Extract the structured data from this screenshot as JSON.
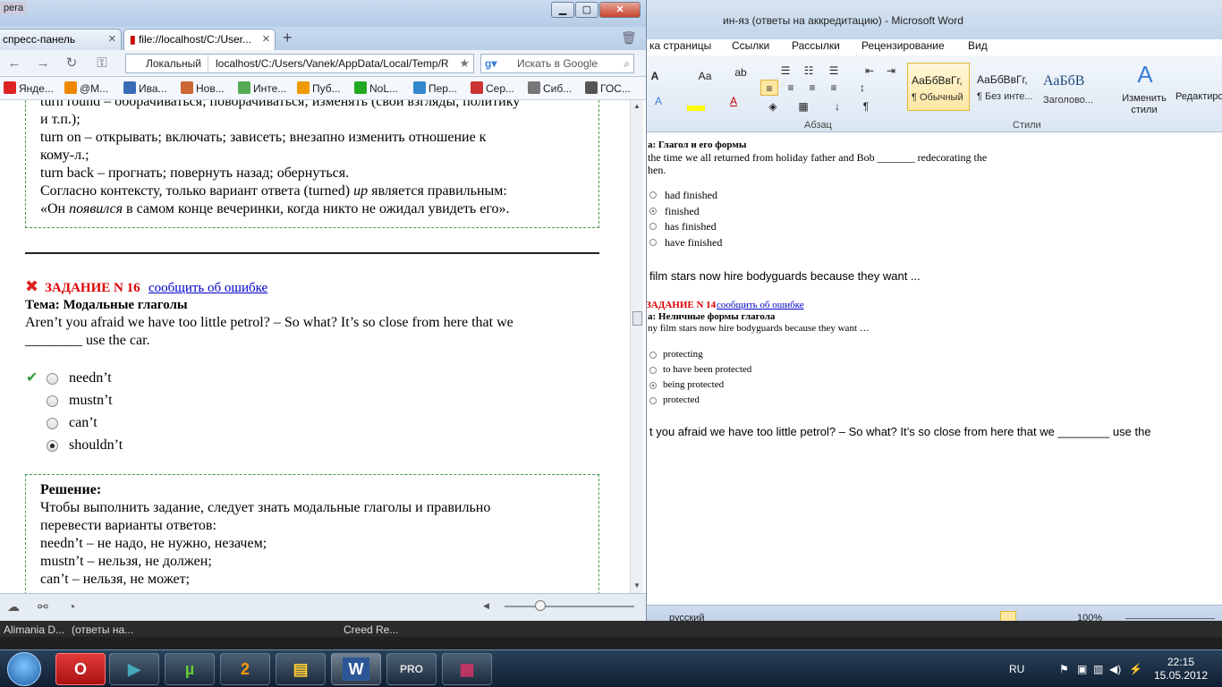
{
  "browser": {
    "app_label": "pera",
    "tabs": [
      {
        "label": "спресс-панель"
      },
      {
        "label": "file://localhost/C:/User..."
      }
    ],
    "new_tab": "+",
    "address": {
      "security_label": "Локальный",
      "url": "localhost/C:/Users/Vanek/AppData/Local/Temp/R"
    },
    "search": {
      "placeholder": "Искать в Google"
    },
    "bookmarks": [
      {
        "label": "Янде...",
        "color": "#d22"
      },
      {
        "label": "@M...",
        "color": "#e80"
      },
      {
        "label": "Ива...",
        "color": "#3a6bb8"
      },
      {
        "label": "Нов...",
        "color": "#c63"
      },
      {
        "label": "Инте...",
        "color": "#5a5"
      },
      {
        "label": "Пуб...",
        "color": "#e90"
      },
      {
        "label": "NoL...",
        "color": "#2a2"
      },
      {
        "label": "Пер...",
        "color": "#38c"
      },
      {
        "label": "Сер...",
        "color": "#c33"
      },
      {
        "label": "Сиб...",
        "color": "#777"
      },
      {
        "label": "ГОС...",
        "color": "#555"
      }
    ],
    "content": {
      "prev_solution": [
        "turn round – оборачиваться; поворачиваться; изменять (свои взгляды, политику",
        "и т.п.);",
        "turn on – открывать; включать; зависеть; внезапно изменить отношение к",
        "кому-л.;",
        "turn back – прогнать; повернуть назад; обернуться."
      ],
      "prev_conclusion_a": "Согласно контексту, только вариант ответа (turned) ",
      "prev_conclusion_b": "up",
      "prev_conclusion_c": " является правильным:",
      "prev_translation_a": "«Он ",
      "prev_translation_b": "появился",
      "prev_translation_c": " в самом конце вечеринки, когда никто не ожидал увидеть его».",
      "task": {
        "title": "ЗАДАНИЕ N 16",
        "report_link": "сообщить об ошибке",
        "topic": "Тема: Модальные глаголы",
        "question_line1": "Aren’t you afraid we have too little petrol? – So what? It’s so close from here that we",
        "question_line2": "________ use the car.",
        "options": [
          "needn’t",
          "mustn’t",
          "can’t",
          "shouldn’t"
        ]
      },
      "solution": {
        "heading": "Решение:",
        "lines": [
          "Чтобы выполнить задание, следует знать модальные глаголы и правильно",
          "перевести варианты ответов:",
          "needn’t – не надо, не нужно, незачем;",
          "mustn’t – нельзя, не должен;",
          "can’t – нельзя, не может;"
        ]
      }
    }
  },
  "word": {
    "title": "ин-яз (ответы на аккредитацию)  -  Microsoft Word",
    "tabs": [
      "ка страницы",
      "Ссылки",
      "Рассылки",
      "Рецензирование",
      "Вид"
    ],
    "styles": [
      {
        "preview": "АаБбВвГг,",
        "name": "¶ Обычный"
      },
      {
        "preview": "АаБбВвГг,",
        "name": "¶ Без инте..."
      },
      {
        "preview": "АаБбВ",
        "name": "Заголово..."
      }
    ],
    "change_styles": "Изменить стили",
    "editing": "Редактиров",
    "group_paragraph": "Абзац",
    "group_styles": "Стили",
    "doc": {
      "topic_a": "а: Глагол и его формы",
      "question_a1": "the time we all returned from holiday father and Bob _______ redecorating the",
      "question_a2": "hen.",
      "options_a": [
        "had finished",
        "finished",
        "has finished",
        "have finished"
      ],
      "line_mid": "film stars now hire bodyguards because they want ...",
      "task14": "ЗАДАНИЕ N 14",
      "task14_link": "сообщить об ошибке",
      "topic_b": "а: Неличные формы глагола",
      "question_b": "ny film stars now hire bodyguards because they want …",
      "options_b": [
        "protecting",
        "to have been protected",
        "being protected",
        "protected"
      ],
      "line_bottom": "t you afraid we have too little petrol? – So what? It’s so close from here that we ________ use the"
    },
    "status": {
      "language": "русский",
      "zoom": "100%"
    }
  },
  "taskstrip": [
    {
      "label": "Alimania D..."
    },
    {
      "label": "(ответы на..."
    },
    {
      "label": "Creed Re..."
    }
  ],
  "tray": {
    "lang": "RU",
    "time": "22:15",
    "date": "15.05.2012"
  }
}
